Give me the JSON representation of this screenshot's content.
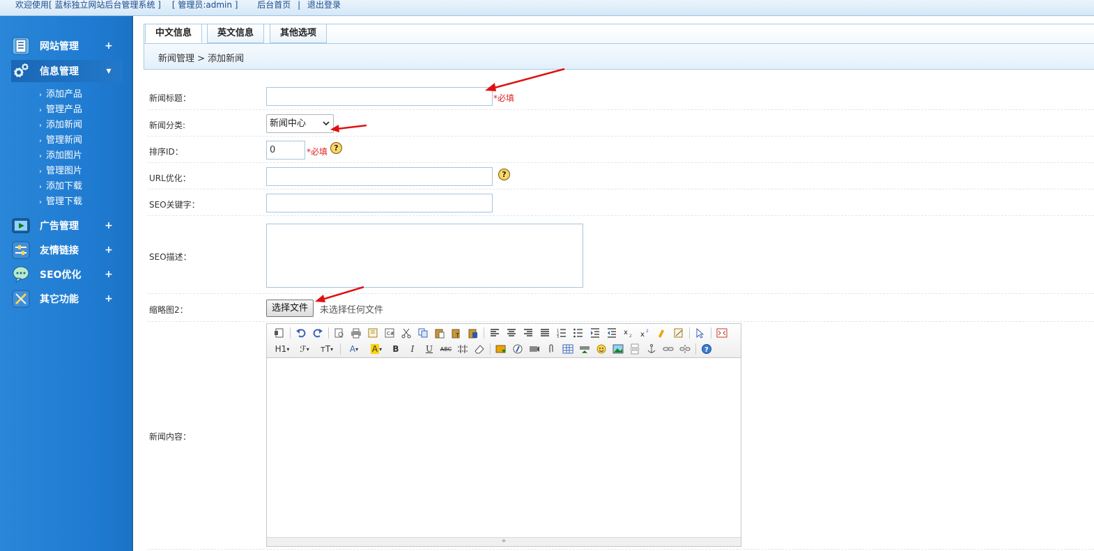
{
  "topbar": {
    "welcome": "欢迎使用[ 蓝标独立网站后台管理系统 ]",
    "admin": "[ 管理员:admin ]",
    "home_link": "后台首页",
    "divider": "|",
    "logout_link": "退出登录"
  },
  "sidebar": {
    "menus": [
      {
        "label": "网站管理",
        "toggle": "+",
        "icon": "list-icon"
      },
      {
        "label": "信息管理",
        "toggle": "▾",
        "icon": "gears-icon"
      },
      {
        "label": "广告管理",
        "toggle": "+",
        "icon": "play-icon"
      },
      {
        "label": "友情链接",
        "toggle": "+",
        "icon": "sliders-icon"
      },
      {
        "label": "SEO优化",
        "toggle": "+",
        "icon": "chat-bubble-icon"
      },
      {
        "label": "其它功能",
        "toggle": "+",
        "icon": "tools-icon"
      }
    ],
    "submenu": [
      "添加产品",
      "管理产品",
      "添加新闻",
      "管理新闻",
      "添加图片",
      "管理图片",
      "添加下载",
      "管理下载"
    ],
    "submenu_arrow": "›"
  },
  "tabs": [
    "中文信息",
    "英文信息",
    "其他选项"
  ],
  "breadcrumb": "新闻管理 > 添加新闻",
  "form": {
    "title_label": "新闻标题：",
    "title_value": "",
    "required_star": "*必填",
    "category_label": "新闻分类:",
    "category_value": "新闻中心",
    "sort_label": "排序ID：",
    "sort_value": "0",
    "required": "*必填",
    "url_label": "URL优化：",
    "url_value": "",
    "seo_kw_label": "SEO关键字：",
    "seo_kw_value": "",
    "seo_desc_label": "SEO描述：",
    "seo_desc_value": "",
    "thumb_label": "缩略图2：",
    "file_button": "选择文件",
    "file_status": "未选择任何文件",
    "content_label": "新闻内容：",
    "help_glyph": "?"
  },
  "editor": {
    "row1": [
      "source",
      "undo",
      "redo",
      "preview",
      "print",
      "template",
      "code",
      "cut",
      "copy",
      "paste",
      "paste-text",
      "paste-word",
      "align-left",
      "align-center",
      "align-right",
      "align-justify",
      "ordered-list",
      "unordered-list",
      "indent",
      "outdent",
      "subscript",
      "superscript",
      "clear-format",
      "select-all",
      "selection",
      "fullscreen"
    ],
    "row2_labels": {
      "heading": "H1",
      "font": "ℱ",
      "size": "тT",
      "fontcolor": "A",
      "bgcolor": "A",
      "bold": "B",
      "italic": "I",
      "underline": "U",
      "strike": "ABC"
    },
    "footer_glyph": "÷"
  },
  "colors": {
    "sidebar": "#1f7bd1",
    "required": "#e02020",
    "arrow": "#e01010",
    "border": "#a8c4de"
  }
}
